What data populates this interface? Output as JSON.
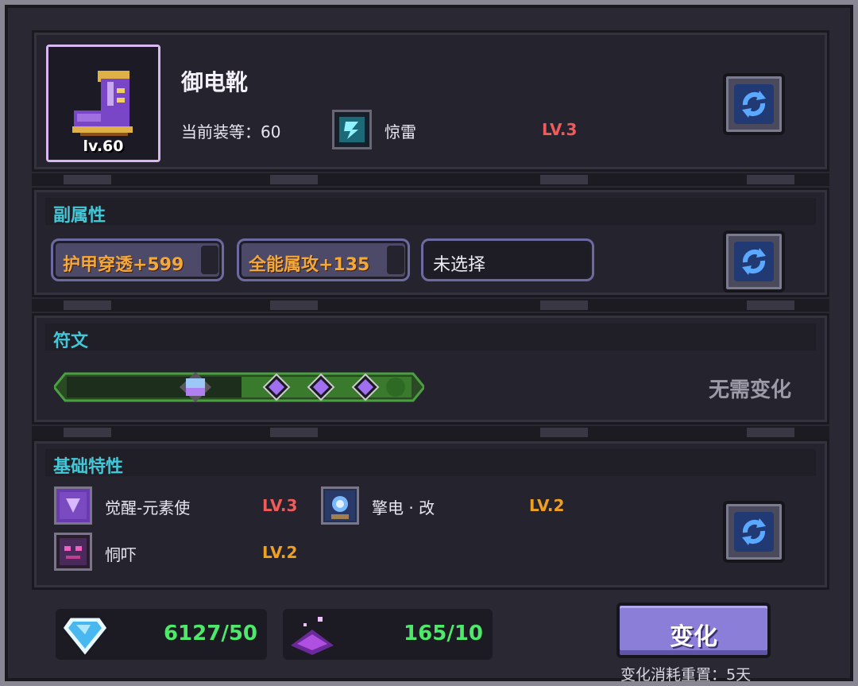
{
  "item": {
    "name": "御电靴",
    "level_badge": "lv.60",
    "gear_score": "当前装等：60",
    "skill": {
      "name": "惊雷",
      "level": "LV.3"
    }
  },
  "sub_attrs": {
    "title": "副属性",
    "pills": [
      {
        "label": "护甲穿透+599"
      },
      {
        "label": "全能属攻+135"
      },
      {
        "label": "未选择"
      }
    ]
  },
  "rune": {
    "title": "符文",
    "status": "无需变化"
  },
  "traits": {
    "title": "基础特性",
    "items": [
      {
        "name": "觉醒-元素使",
        "level": "LV.3",
        "level_color": "#f05a5a"
      },
      {
        "name": "擎电 · 改",
        "level": "LV.2",
        "level_color": "#f0a020"
      },
      {
        "name": "恫吓",
        "level": "LV.2",
        "level_color": "#f0a020"
      }
    ]
  },
  "currency": {
    "gem": "6127/50",
    "dust": "165/10"
  },
  "actions": {
    "change_label": "变化",
    "reset_note": "变化消耗重置：5天"
  },
  "colors": {
    "title_cyan": "#43c6d6",
    "accent_green": "#4ee86a",
    "level_red": "#f05a5a",
    "level_orange": "#f0a020",
    "button_purple": "#8a7ed8"
  }
}
